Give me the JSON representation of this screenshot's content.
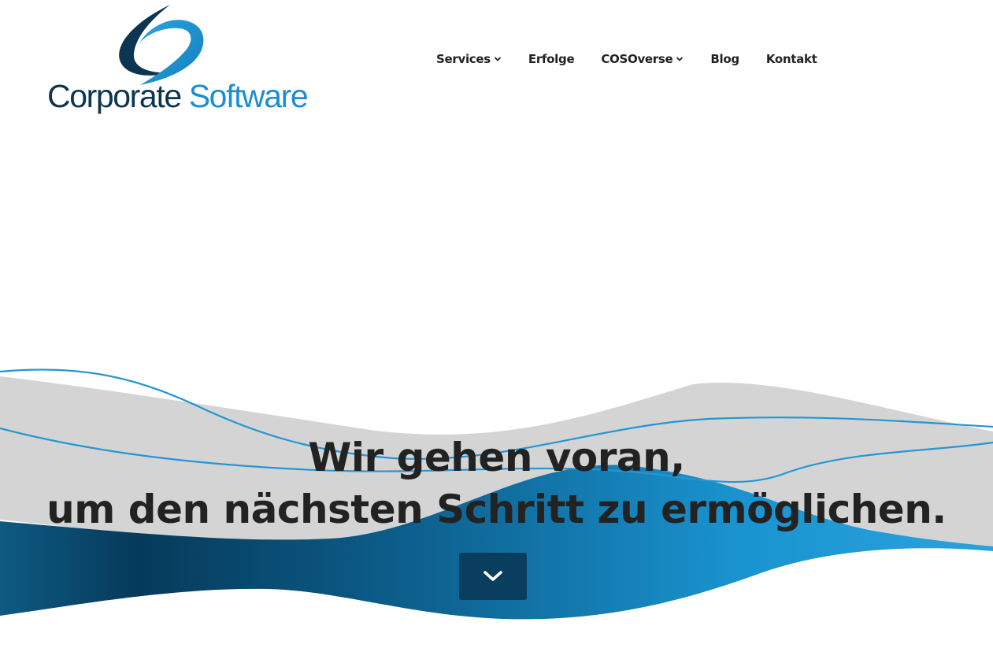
{
  "header": {
    "logo": {
      "word1": "Corporate",
      "word2": "Software",
      "color_dark": "#0b3550",
      "color_light": "#1b8fce"
    },
    "nav": {
      "services": "Services",
      "erfolge": "Erfolge",
      "cosoverse": "COSOverse",
      "blog": "Blog",
      "kontakt": "Kontakt"
    }
  },
  "hero": {
    "headline_line1": "Wir gehen voran,",
    "headline_line2": "um den nächsten Schritt zu ermöglichen.",
    "scroll_icon": "chevron-down-icon",
    "colors": {
      "wave_gray": "#d4d4d4",
      "wave_blue_dark": "#0a3e5e",
      "wave_blue_light": "#1a94d0",
      "wave_line": "#2596d4",
      "button": "#0a3e5e"
    }
  }
}
